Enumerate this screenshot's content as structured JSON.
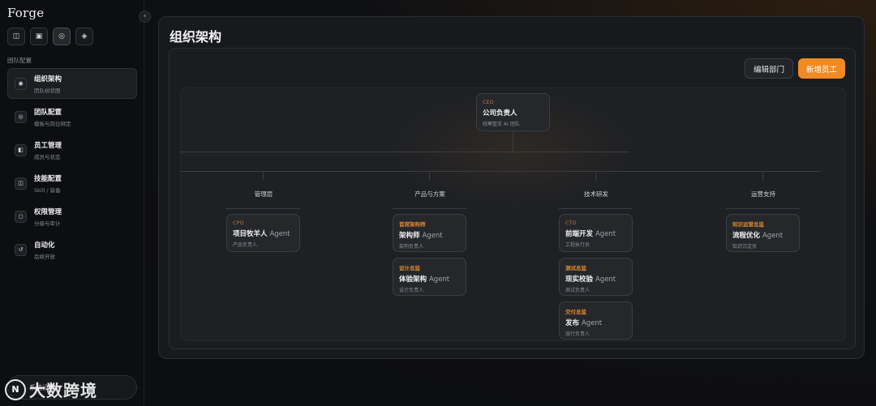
{
  "app": {
    "brand": "Forge",
    "collapse_icon": "‹"
  },
  "mode_buttons": [
    {
      "icon": "◫",
      "name": "layout-icon"
    },
    {
      "icon": "▣",
      "name": "square-icon"
    },
    {
      "icon": "◎",
      "name": "target-icon"
    },
    {
      "icon": "◈",
      "name": "diamond-icon"
    }
  ],
  "sidebar": {
    "section_label": "团队配置",
    "items": [
      {
        "title": "组织架构",
        "subtitle": "团队树状图",
        "icon": "◉"
      },
      {
        "title": "团队配置",
        "subtitle": "模板与岗位绑定",
        "icon": "◎"
      },
      {
        "title": "员工管理",
        "subtitle": "成员与状态",
        "icon": "◧"
      },
      {
        "title": "技能配置",
        "subtitle": "Skill / 装备",
        "icon": "◫"
      },
      {
        "title": "权限管理",
        "subtitle": "分级与审计",
        "icon": "○"
      },
      {
        "title": "自动化",
        "subtitle": "后续开放",
        "icon": "↺"
      }
    ],
    "settings_label": "系统设置"
  },
  "watermark": {
    "logo": "N",
    "text": "大数跨境"
  },
  "main": {
    "title": "组织架构",
    "edit_button": "编辑部门",
    "add_button": "新增员工"
  },
  "org": {
    "ceo": {
      "role": "CEO",
      "name": "公司负责人",
      "suffix": "",
      "desc": "统筹整支 AI 团队"
    },
    "departments": [
      {
        "label": "管理层",
        "cards": [
          {
            "role": "CPO",
            "name": "项目牧羊人",
            "suffix": "Agent",
            "desc": "产品负责人"
          }
        ]
      },
      {
        "label": "产品与方案",
        "cards": [
          {
            "role": "首席架构师",
            "name": "架构师",
            "suffix": "Agent",
            "desc": "架构负责人"
          },
          {
            "role": "设计总监",
            "name": "体验架构",
            "suffix": "Agent",
            "desc": "设计负责人"
          }
        ]
      },
      {
        "label": "技术研发",
        "cards": [
          {
            "role": "CTO",
            "name": "前端开发",
            "suffix": "Agent",
            "desc": "工程执行员"
          },
          {
            "role": "测试总监",
            "name": "现实校验",
            "suffix": "Agent",
            "desc": "测试负责人"
          },
          {
            "role": "交付总监",
            "name": "发布",
            "suffix": "Agent",
            "desc": "旅行负责人"
          }
        ]
      },
      {
        "label": "运营支持",
        "cards": [
          {
            "role": "知识运营总监",
            "name": "流程优化",
            "suffix": "Agent",
            "desc": "知识沉淀员"
          }
        ]
      }
    ]
  }
}
